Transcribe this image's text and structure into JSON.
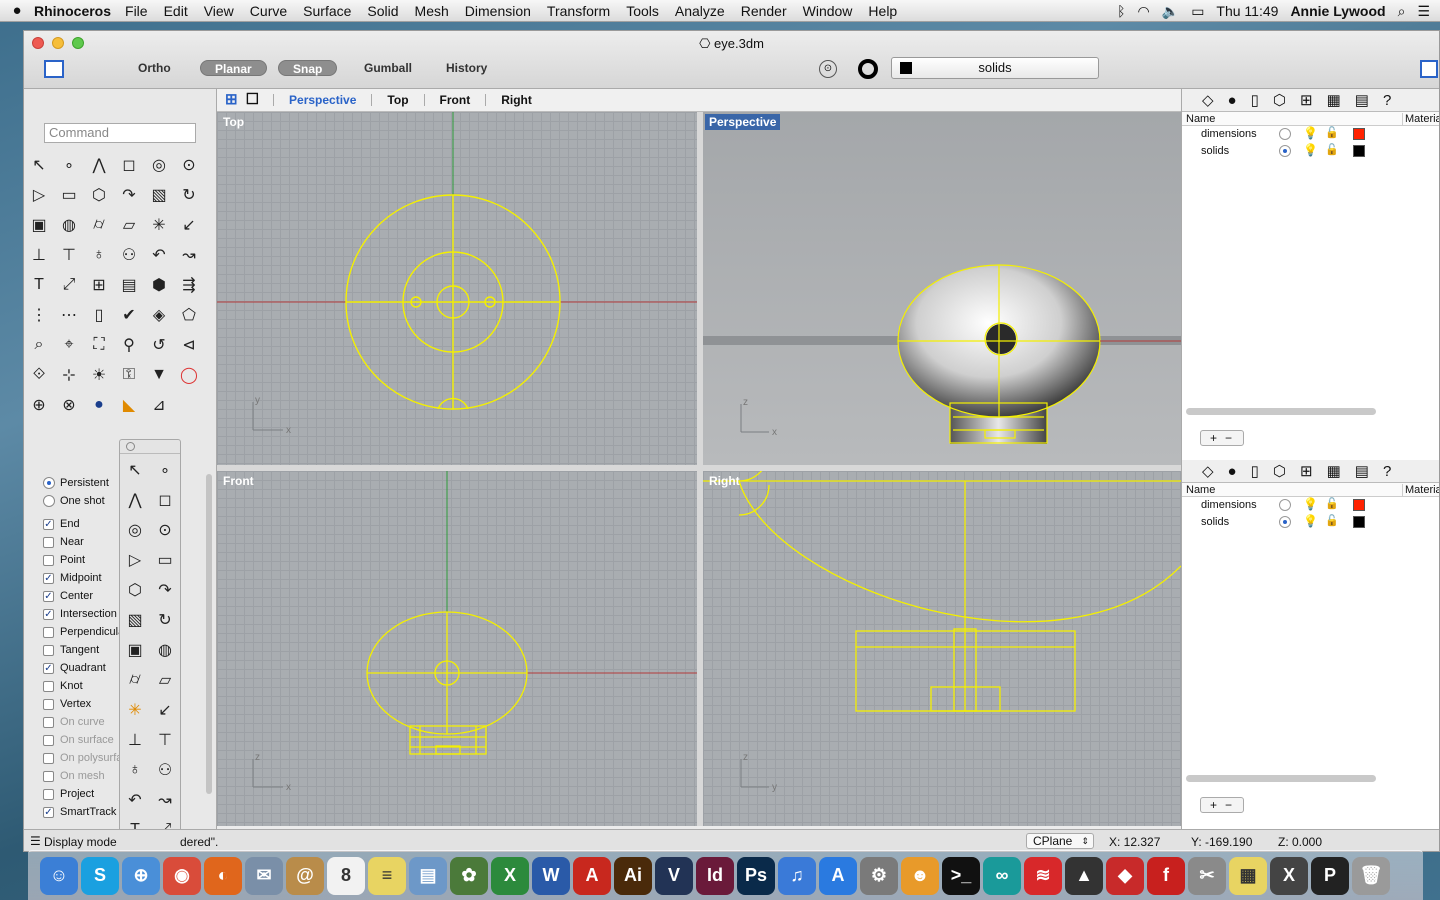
{
  "menubar": {
    "app": "Rhinoceros",
    "menus": [
      "File",
      "Edit",
      "View",
      "Curve",
      "Surface",
      "Solid",
      "Mesh",
      "Dimension",
      "Transform",
      "Tools",
      "Analyze",
      "Render",
      "Window",
      "Help"
    ],
    "clock": "Thu 11:49",
    "user": "Annie Lywood"
  },
  "window": {
    "title": "eye.3dm",
    "toolbar": {
      "ortho": "Ortho",
      "planar": "Planar",
      "snap": "Snap",
      "gumball": "Gumball",
      "history": "History",
      "current_layer": "solids"
    }
  },
  "viewport_tabs": [
    "Perspective",
    "Top",
    "Front",
    "Right"
  ],
  "active_tab": "Perspective",
  "command": {
    "placeholder": "Command"
  },
  "osnap": {
    "mode_persistent": "Persistent",
    "mode_oneshot": "One shot",
    "items": [
      {
        "label": "End",
        "checked": true,
        "enabled": true
      },
      {
        "label": "Near",
        "checked": false,
        "enabled": true
      },
      {
        "label": "Point",
        "checked": false,
        "enabled": true
      },
      {
        "label": "Midpoint",
        "checked": true,
        "enabled": true
      },
      {
        "label": "Center",
        "checked": true,
        "enabled": true
      },
      {
        "label": "Intersection",
        "checked": true,
        "enabled": true
      },
      {
        "label": "Perpendicular",
        "checked": false,
        "enabled": true
      },
      {
        "label": "Tangent",
        "checked": false,
        "enabled": true
      },
      {
        "label": "Quadrant",
        "checked": true,
        "enabled": true
      },
      {
        "label": "Knot",
        "checked": false,
        "enabled": true
      },
      {
        "label": "Vertex",
        "checked": false,
        "enabled": true
      },
      {
        "label": "On curve",
        "checked": false,
        "enabled": false
      },
      {
        "label": "On surface",
        "checked": false,
        "enabled": false
      },
      {
        "label": "On polysurface",
        "checked": false,
        "enabled": false
      },
      {
        "label": "On mesh",
        "checked": false,
        "enabled": false
      },
      {
        "label": "Project",
        "checked": false,
        "enabled": true
      },
      {
        "label": "SmartTrack",
        "checked": true,
        "enabled": true
      }
    ]
  },
  "viewports": {
    "top": "Top",
    "perspective": "Perspective",
    "front": "Front",
    "right": "Right",
    "axis_x": "x",
    "axis_y": "y",
    "axis_z": "z"
  },
  "layers_panel": {
    "col_name": "Name",
    "col_material": "Materia",
    "layers": [
      {
        "name": "dimensions",
        "current": false,
        "on": true,
        "color": "#ff2200"
      },
      {
        "name": "solids",
        "current": true,
        "on": false,
        "color": "#000000"
      }
    ],
    "add": "+",
    "remove": "−"
  },
  "status": {
    "display_mode": "Display mode",
    "message": "dered\".",
    "cplane": "CPlane",
    "x": "X: 12.327",
    "y": "Y: -169.190",
    "z": "Z: 0.000"
  },
  "dock": {
    "icons": [
      {
        "name": "finder",
        "glyph": "☺",
        "color": "#3b7fd6"
      },
      {
        "name": "skype",
        "glyph": "S",
        "color": "#1aa0e0"
      },
      {
        "name": "safari",
        "glyph": "⊕",
        "color": "#4a8fd8"
      },
      {
        "name": "chrome",
        "glyph": "◉",
        "color": "#d94c3a"
      },
      {
        "name": "firefox",
        "glyph": "◐",
        "color": "#e0661c"
      },
      {
        "name": "mail",
        "glyph": "✉",
        "color": "#7a8fa8"
      },
      {
        "name": "contacts",
        "glyph": "@",
        "color": "#b98c4a"
      },
      {
        "name": "calendar",
        "glyph": "8",
        "color": "#f2f2f2"
      },
      {
        "name": "notes",
        "glyph": "≡",
        "color": "#e8d462"
      },
      {
        "name": "preview",
        "glyph": "▤",
        "color": "#6d98c8"
      },
      {
        "name": "photos",
        "glyph": "✿",
        "color": "#4b7a3a"
      },
      {
        "name": "excel",
        "glyph": "X",
        "color": "#2c8a3c"
      },
      {
        "name": "word",
        "glyph": "W",
        "color": "#2a5aa8"
      },
      {
        "name": "acrobat",
        "glyph": "A",
        "color": "#c8281e"
      },
      {
        "name": "illustrator",
        "glyph": "Ai",
        "color": "#4a2a0a"
      },
      {
        "name": "vectorworks",
        "glyph": "V",
        "color": "#223355"
      },
      {
        "name": "indesign",
        "glyph": "Id",
        "color": "#6a1a3a"
      },
      {
        "name": "photoshop",
        "glyph": "Ps",
        "color": "#0a2a4a"
      },
      {
        "name": "itunes",
        "glyph": "♫",
        "color": "#3a7ad8"
      },
      {
        "name": "app-store",
        "glyph": "A",
        "color": "#2a7ae0"
      },
      {
        "name": "system-preferences",
        "glyph": "⚙",
        "color": "#7a7a7a"
      },
      {
        "name": "scratch",
        "glyph": "☻",
        "color": "#e89a2a"
      },
      {
        "name": "terminal",
        "glyph": ">_",
        "color": "#111111"
      },
      {
        "name": "arduino",
        "glyph": "∞",
        "color": "#1a9a9a"
      },
      {
        "name": "transmit",
        "glyph": "≋",
        "color": "#d8282a"
      },
      {
        "name": "inkscape",
        "glyph": "▲",
        "color": "#333333"
      },
      {
        "name": "rhino",
        "glyph": "◆",
        "color": "#c82a2a"
      },
      {
        "name": "filezilla",
        "glyph": "f",
        "color": "#c8201e"
      },
      {
        "name": "xcode-tools",
        "glyph": "✂",
        "color": "#8a8a8a"
      },
      {
        "name": "stickies",
        "glyph": "▦",
        "color": "#e8d462"
      },
      {
        "name": "x11",
        "glyph": "X",
        "color": "#444444"
      },
      {
        "name": "processing",
        "glyph": "P",
        "color": "#222222"
      },
      {
        "name": "trash",
        "glyph": "🗑",
        "color": "#9a9a9a"
      }
    ]
  }
}
